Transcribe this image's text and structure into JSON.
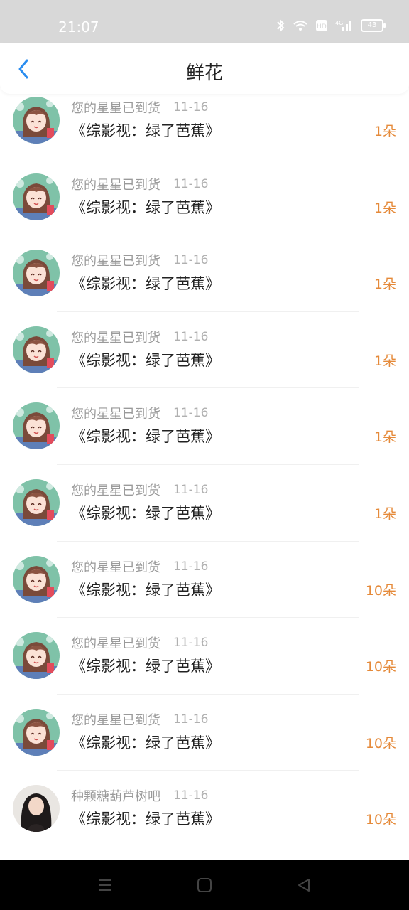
{
  "status_bar": {
    "time": "21:07",
    "battery": "43",
    "network": "4G",
    "hd": "HD"
  },
  "header": {
    "title": "鲜花"
  },
  "colors": {
    "accent_blue": "#2a8df0",
    "amount_orange": "#e58a3a"
  },
  "items": [
    {
      "name": "您的星星已到货",
      "date": "11-16",
      "book": "《综影视：绿了芭蕉》",
      "amount": "1朵",
      "avatar": "anime-girl"
    },
    {
      "name": "您的星星已到货",
      "date": "11-16",
      "book": "《综影视：绿了芭蕉》",
      "amount": "1朵",
      "avatar": "anime-girl"
    },
    {
      "name": "您的星星已到货",
      "date": "11-16",
      "book": "《综影视：绿了芭蕉》",
      "amount": "1朵",
      "avatar": "anime-girl"
    },
    {
      "name": "您的星星已到货",
      "date": "11-16",
      "book": "《综影视：绿了芭蕉》",
      "amount": "1朵",
      "avatar": "anime-girl"
    },
    {
      "name": "您的星星已到货",
      "date": "11-16",
      "book": "《综影视：绿了芭蕉》",
      "amount": "1朵",
      "avatar": "anime-girl"
    },
    {
      "name": "您的星星已到货",
      "date": "11-16",
      "book": "《综影视：绿了芭蕉》",
      "amount": "1朵",
      "avatar": "anime-girl"
    },
    {
      "name": "您的星星已到货",
      "date": "11-16",
      "book": "《综影视：绿了芭蕉》",
      "amount": "10朵",
      "avatar": "anime-girl"
    },
    {
      "name": "您的星星已到货",
      "date": "11-16",
      "book": "《综影视：绿了芭蕉》",
      "amount": "10朵",
      "avatar": "anime-girl"
    },
    {
      "name": "您的星星已到货",
      "date": "11-16",
      "book": "《综影视：绿了芭蕉》",
      "amount": "10朵",
      "avatar": "anime-girl"
    },
    {
      "name": "种颗糖葫芦树吧",
      "date": "11-16",
      "book": "《综影视：绿了芭蕉》",
      "amount": "10朵",
      "avatar": "photo-girl"
    }
  ]
}
